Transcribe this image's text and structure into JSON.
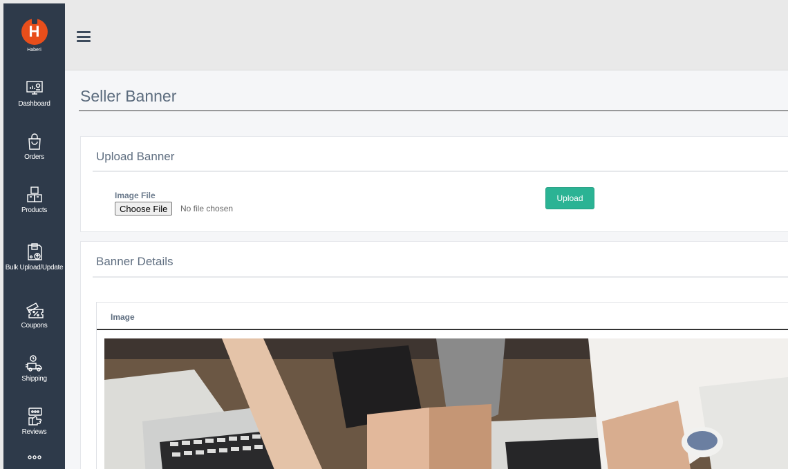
{
  "brand": {
    "name": "Haberi"
  },
  "sidebar": {
    "items": [
      {
        "label": "Dashboard",
        "icon": "dashboard-icon"
      },
      {
        "label": "Orders",
        "icon": "shopping-bag-icon"
      },
      {
        "label": "Products",
        "icon": "boxes-icon"
      },
      {
        "label": "Bulk Upload/Update",
        "icon": "bulk-upload-icon"
      },
      {
        "label": "Coupons",
        "icon": "coupon-icon"
      },
      {
        "label": "Shipping",
        "icon": "shipping-icon"
      },
      {
        "label": "Reviews",
        "icon": "reviews-icon"
      }
    ]
  },
  "page": {
    "title": "Seller Banner"
  },
  "upload": {
    "title": "Upload Banner",
    "field_label": "Image File",
    "choose_button": "Choose File",
    "file_status": "No file chosen",
    "upload_button": "Upload"
  },
  "details": {
    "title": "Banner Details",
    "columns": [
      "Image"
    ]
  },
  "colors": {
    "sidebar": "#2e3a4a",
    "accent": "#2bb394",
    "logo": "#e84e1b"
  }
}
